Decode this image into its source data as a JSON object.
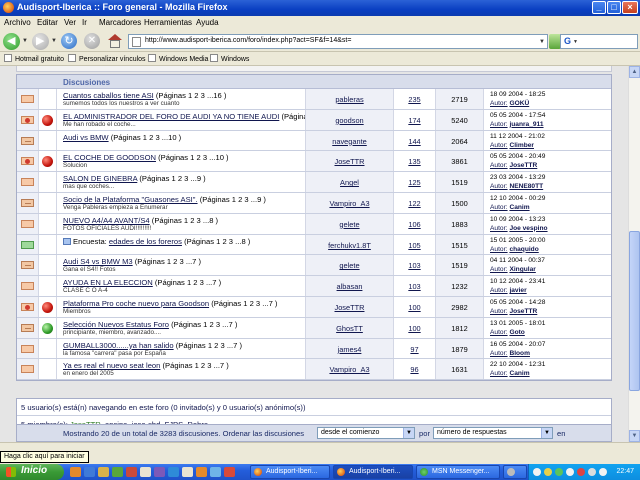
{
  "window": {
    "title": "Audisport-Iberica :: Foro general - Mozilla Firefox",
    "min": "_",
    "max": "□",
    "close": "×"
  },
  "menu": [
    "Archivo",
    "Editar",
    "Ver",
    "Ir",
    "Marcadores",
    "Herramientas",
    "Ayuda"
  ],
  "nav": {
    "url": "http://www.audisport-iberica.com/foro/index.php?act=SF&f=14&st="
  },
  "bookmarks": [
    "Hotmail gratuito",
    "Personalizar vínculos",
    "Windows Media",
    "Windows"
  ],
  "forum": {
    "section_title": "Discusiones",
    "rows": [
      {
        "title": "Cuantos caballos tiene ASI",
        "pages": "(Páginas 1 2 3 ...16 )",
        "desc": "sumemos todos los nuestros a ver cuanto",
        "author": "pableras",
        "replies": "235",
        "views": "2719",
        "date": "18 09 2004 - 18:25",
        "last_label": "Autor:",
        "last_author": "GOKÜ",
        "status": ""
      },
      {
        "title": "EL ADMINISTRADOR DEL FORO DE AUDI YA NO TIENE AUDI",
        "pages": "(Páginas 1 2 3 ...12 )",
        "desc": "Me han robado el coche...",
        "author": "goodson",
        "replies": "174",
        "views": "5240",
        "date": "05 05 2004 - 17:54",
        "last_label": "Autor:",
        "last_author": "juanra_911",
        "status": "red"
      },
      {
        "title": "Audi vs BMW",
        "pages": "(Páginas 1 2 3 ...10 )",
        "desc": "",
        "author": "navegante",
        "replies": "144",
        "views": "2064",
        "date": "11 12 2004 - 21:02",
        "last_label": "Autor:",
        "last_author": "Climber",
        "status": ""
      },
      {
        "title": "EL COCHE DE GOODSON",
        "pages": "(Páginas 1 2 3 ...10 )",
        "desc": "Solucion",
        "author": "JoseTTR",
        "replies": "135",
        "views": "3861",
        "date": "05 05 2004 - 20:49",
        "last_label": "Autor:",
        "last_author": "JoseTTR",
        "status": "red"
      },
      {
        "title": "SALON DE GINEBRA",
        "pages": "(Páginas 1 2 3 ...9 )",
        "desc": "mas que coches...",
        "author": "Angel",
        "replies": "125",
        "views": "1519",
        "date": "23 03 2004 - 13:29",
        "last_label": "Autor:",
        "last_author": "NENE80TT",
        "status": ""
      },
      {
        "title": "Socio de la Plataforma \"Guasones ASI\".",
        "pages": "(Páginas 1 2 3 ...9 )",
        "desc": "Venga Pableras empieza a Enumerar",
        "author": "Vampiro_A3",
        "replies": "122",
        "views": "1500",
        "date": "12 10 2004 - 00:29",
        "last_label": "Autor:",
        "last_author": "Canim",
        "status": ""
      },
      {
        "title": "NUEVO A4/A4 AVANT/S4",
        "pages": "(Páginas 1 2 3 ...8 )",
        "desc": "FOTOS OFICIALES AUDI!!!!!!!!!",
        "author": "gelete",
        "replies": "106",
        "views": "1883",
        "date": "10 09 2004 - 13:23",
        "last_label": "Autor:",
        "last_author": "Joe vespino",
        "status": ""
      },
      {
        "title": "edades de los foreros",
        "prefix": "Encuesta:",
        "pages": "(Páginas 1 2 3 ...8 )",
        "desc": "",
        "author": "ferchukv1.8T",
        "replies": "105",
        "views": "1515",
        "date": "15 01 2005 - 20:00",
        "last_label": "Autor:",
        "last_author": "chaquido",
        "status": "",
        "icon": "green"
      },
      {
        "title": "Audi S4 vs BMW M3",
        "pages": "(Páginas 1 2 3 ...7 )",
        "desc": "Gana el S4!! Fotos",
        "author": "gelete",
        "replies": "103",
        "views": "1519",
        "date": "04 11 2004 - 00:37",
        "last_label": "Autor:",
        "last_author": "Xingular",
        "status": ""
      },
      {
        "title": "AYUDA EN LA ELECCION",
        "pages": "(Páginas 1 2 3 ...7 )",
        "desc": "CLASE C O A-4",
        "author": "albasan",
        "replies": "103",
        "views": "1232",
        "date": "10 12 2004 - 23:41",
        "last_label": "Autor:",
        "last_author": "javier",
        "status": ""
      },
      {
        "title": "Plataforma Pro coche nuevo para Goodson",
        "pages": "(Páginas 1 2 3 ...7 )",
        "desc": "Miembros",
        "author": "JoseTTR",
        "replies": "100",
        "views": "2982",
        "date": "05 05 2004 - 14:28",
        "last_label": "Autor:",
        "last_author": "JoseTTR",
        "status": "red"
      },
      {
        "title": "Selección Nuevos Estatus Foro",
        "pages": "(Páginas 1 2 3 ...7 )",
        "desc": "principiante, miembro, avanzado....",
        "author": "GhosTT",
        "replies": "100",
        "views": "1812",
        "date": "13 01 2005 - 18:01",
        "last_label": "Autor:",
        "last_author": "Goto",
        "status": "green"
      },
      {
        "title": "GUMBALL3000......ya han salido",
        "pages": "(Páginas 1 2 3 ...7 )",
        "desc": "la famosa \"carrera\" pasa por España",
        "author": "james4",
        "replies": "97",
        "views": "1879",
        "date": "16 05 2004 - 20:07",
        "last_label": "Autor:",
        "last_author": "Bloom",
        "status": ""
      },
      {
        "title": "Ya es real el nuevo seat leon",
        "pages": "(Páginas 1 2 3 ...7 )",
        "desc": "en enero del 2005",
        "author": "Vampiro_A3",
        "replies": "96",
        "views": "1631",
        "date": "22 10 2004 - 12:31",
        "last_label": "Autor:",
        "last_author": "Canim",
        "status": ""
      }
    ]
  },
  "online": {
    "line1": "5 usuario(s) está(n) navegando en este foro (0 invitado(s) y 0 usuario(s) anónimo(s))",
    "members_label": "5 miembro(s):",
    "members": [
      "JoseTTR",
      "ansipa",
      "jose-sbd",
      "FJPS",
      "Robre"
    ]
  },
  "footer": {
    "text": "Mostrando 20 de un total de 3283 discusiones. Ordenar las discusiones",
    "sel1": "desde el comienzo",
    "por": "por",
    "sel2": "número de respuestas",
    "en": "en"
  },
  "status": {
    "tooltip": "Haga clic aquí para iniciar"
  },
  "taskbar": {
    "start": "Inicio",
    "tasks": [
      "Audisport-Iberi...",
      "Audisport-Iberi...",
      "MSN Messenger...",
      "Administrador d..."
    ],
    "clock": "22:47"
  }
}
